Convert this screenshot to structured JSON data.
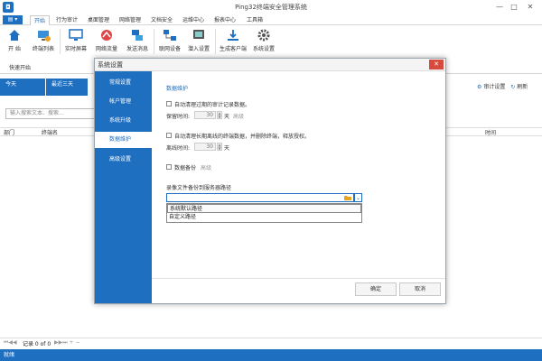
{
  "window": {
    "title": "Ping32终端安全管理系统",
    "min": "—",
    "max": "□",
    "close": "✕"
  },
  "menu": {
    "app_btn": "▤ ▾",
    "tabs": [
      "开始",
      "行为审计",
      "桌面管理",
      "网络管理",
      "文档安全",
      "运维中心",
      "报表中心",
      "工具箱"
    ]
  },
  "ribbon": {
    "buttons": [
      "开 始",
      "终端列表",
      "实时屏幕",
      "网络流量",
      "发送消息",
      "联网设备",
      "潜入设置",
      "生成客户端",
      "系统设置"
    ],
    "group": "快速开始"
  },
  "datebar": {
    "tabs": [
      "今天",
      "最近三天"
    ],
    "audit_settings": "审计设置",
    "refresh": "刷新"
  },
  "list": {
    "search_placeholder": "输入搜索文本、搜索...",
    "columns": [
      "部门",
      "终端名",
      "时间"
    ]
  },
  "pager": {
    "text": "记录 0 of 0"
  },
  "status": {
    "text": "就绪"
  },
  "dialog": {
    "title": "系统设置",
    "close": "✕",
    "nav": [
      "常规设置",
      "帐户管理",
      "系统升级",
      "数据维护",
      "高级设置"
    ],
    "active_nav": 3,
    "section_title": "数据维护",
    "auto_clean_label": "自动清理过期的审计记录数据。",
    "keep_time_label": "保留时间:",
    "keep_time_value": "30",
    "keep_time_unit": "天",
    "keep_time_extra": "高级",
    "auto_clean_offline_label": "自动清理长期离线的终端数据，并删除终端，释放授权。",
    "offline_time_label": "离线时间:",
    "offline_time_value": "30",
    "offline_time_unit": "天",
    "backup_label": "数据备份",
    "backup_extra": "高级",
    "record_path_label": "录像文件备份到服务器路径",
    "dropdown_options": [
      "系统默认路径",
      "自定义路径"
    ],
    "ok_button": "确定",
    "cancel_button": "取消"
  },
  "colors": {
    "accent": "#1e6fc0",
    "nav_bg": "#1f6fc1",
    "close_red": "#d84a3d"
  }
}
